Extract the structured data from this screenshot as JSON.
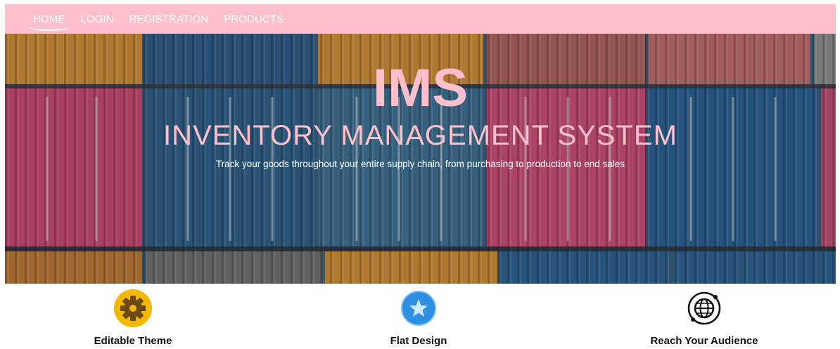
{
  "nav": {
    "items": [
      {
        "label": "HOME",
        "active": true
      },
      {
        "label": "LOGIN",
        "active": false
      },
      {
        "label": "REGISTRATION",
        "active": false
      },
      {
        "label": "PRODUCTS",
        "active": false
      }
    ],
    "background": "#ffc0cb"
  },
  "hero": {
    "title": "IMS",
    "subtitle": "INVENTORY MANAGEMENT SYSTEM",
    "tagline": "Track your goods throughout your entire supply chain, from purchasing to production to end sales",
    "text_color": "#ffc0cb"
  },
  "features": [
    {
      "label": "Editable Theme",
      "icon": "gear-icon"
    },
    {
      "label": "Flat Design",
      "icon": "star-icon"
    },
    {
      "label": "Reach Your Audience",
      "icon": "globe-icon"
    }
  ]
}
